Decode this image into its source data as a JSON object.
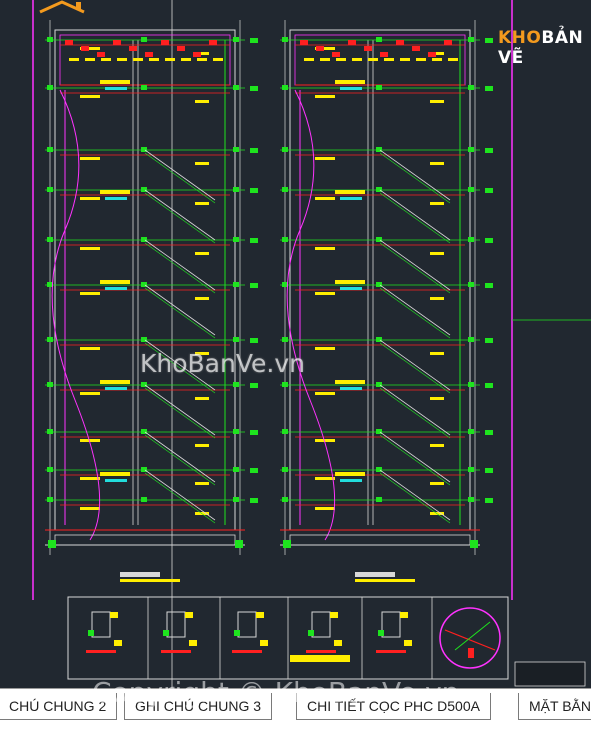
{
  "logo": {
    "part1": "KHO",
    "part2": "BẢN VẼ"
  },
  "watermark": "KhoBanVe.vn",
  "copyright": "Copyright © KhoBanVe.vn",
  "tabs": [
    {
      "label": "CHÚ CHUNG 2"
    },
    {
      "label": "GHI CHÚ CHUNG 3"
    },
    {
      "label": "CHI TIẾT CỌC PHC D500A"
    },
    {
      "label": "MẶT BẰNG"
    }
  ],
  "colors": {
    "background": "#212830",
    "grid_white": "#d8d8d8",
    "green": "#1ee41e",
    "yellow": "#ffee00",
    "red": "#ff2020",
    "magenta": "#ff33ff",
    "cyan": "#22dddd",
    "brand_orange": "#f39a1e"
  }
}
